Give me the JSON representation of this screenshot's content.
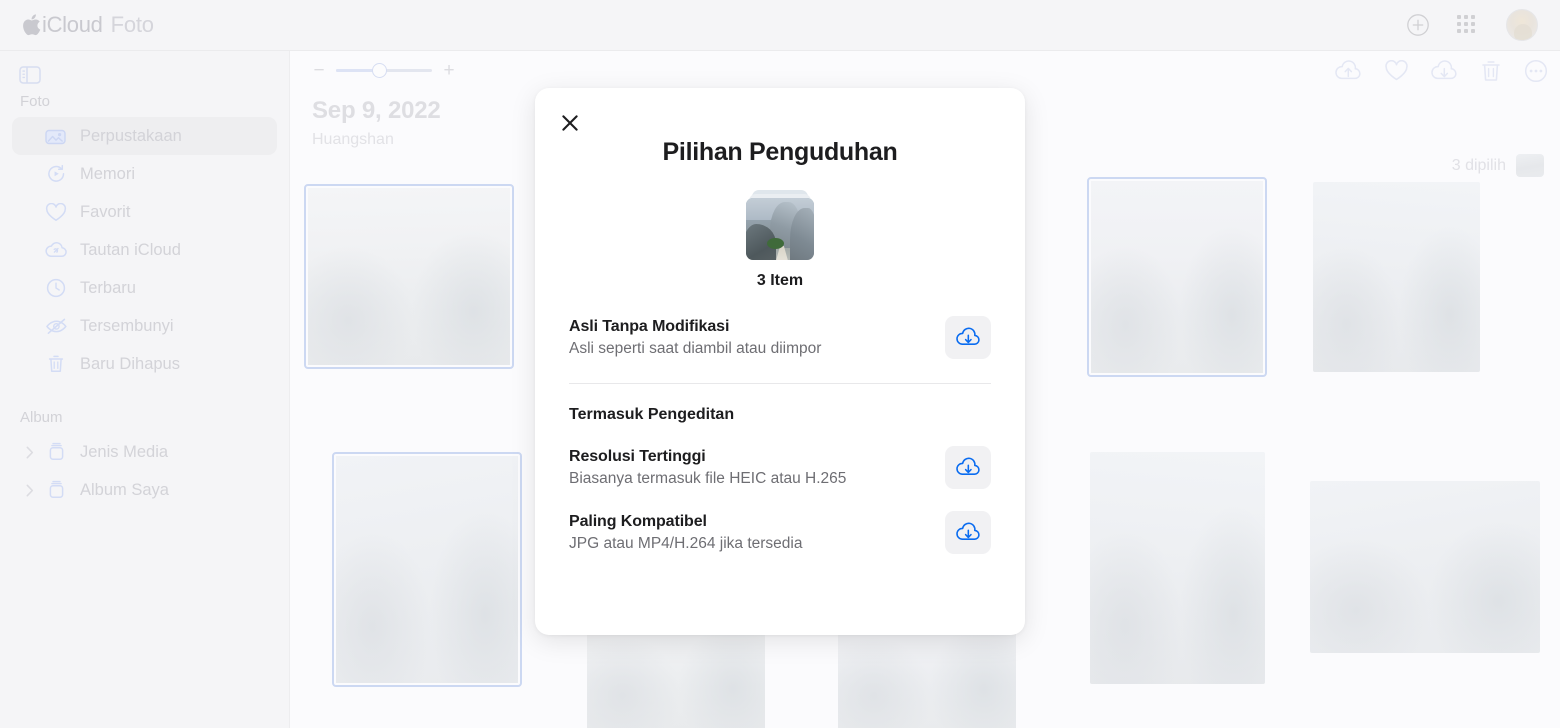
{
  "topbar": {
    "brand_icloud": "iCloud",
    "brand_app": "Foto",
    "icons": {
      "add": "plus-circle-icon",
      "apps": "app-grid-icon",
      "avatar": "user-avatar"
    }
  },
  "sidebar": {
    "toggle_icon": "sidebar-toggle-icon",
    "sections": [
      {
        "label": "Foto",
        "items": [
          {
            "label": "Perpustakaan",
            "icon": "photos-library-icon",
            "selected": true
          },
          {
            "label": "Memori",
            "icon": "memories-icon",
            "selected": false
          },
          {
            "label": "Favorit",
            "icon": "heart-icon",
            "selected": false
          },
          {
            "label": "Tautan iCloud",
            "icon": "icloud-link-icon",
            "selected": false
          },
          {
            "label": "Terbaru",
            "icon": "clock-icon",
            "selected": false
          },
          {
            "label": "Tersembunyi",
            "icon": "eye-slash-icon",
            "selected": false
          },
          {
            "label": "Baru Dihapus",
            "icon": "trash-icon",
            "selected": false
          }
        ]
      },
      {
        "label": "Album",
        "items": [
          {
            "label": "Jenis Media",
            "icon": "album-icon",
            "selected": false
          },
          {
            "label": "Album Saya",
            "icon": "album-icon",
            "selected": false
          }
        ]
      }
    ]
  },
  "content": {
    "zoom": {
      "minus": "−",
      "plus": "+",
      "value": 50
    },
    "date_heading": "Sep 9, 2022",
    "location": "Huangshan",
    "toolbar_icons": [
      "cloud-upload-icon",
      "heart-icon",
      "cloud-download-icon",
      "trash-icon",
      "more-circle-icon"
    ],
    "selection_status": "3 dipilih"
  },
  "modal": {
    "close_icon": "close-icon",
    "title": "Pilihan Penguduhan",
    "thumbnail_icon": "photo-stack-thumbnail",
    "item_count": "3 Item",
    "options_primary": [
      {
        "title": "Asli Tanpa Modifikasi",
        "subtitle": "Asli seperti saat diambil atau diimpor",
        "button_icon": "cloud-download-icon"
      }
    ],
    "group_title": "Termasuk Pengeditan",
    "options_group": [
      {
        "title": "Resolusi Tertinggi",
        "subtitle": "Biasanya termasuk file HEIC atau H.265",
        "button_icon": "cloud-download-icon"
      },
      {
        "title": "Paling Kompatibel",
        "subtitle": "JPG atau MP4/H.264 jika tersedia",
        "button_icon": "cloud-download-icon"
      }
    ]
  },
  "colors": {
    "accent_blue": "#0a6cf0",
    "selection_border": "#ccd8f2",
    "page_bg": "#fbfbfd",
    "chrome_bg": "#f5f5f7",
    "text_primary": "#1d1d1f",
    "text_secondary": "#6e6e73"
  }
}
